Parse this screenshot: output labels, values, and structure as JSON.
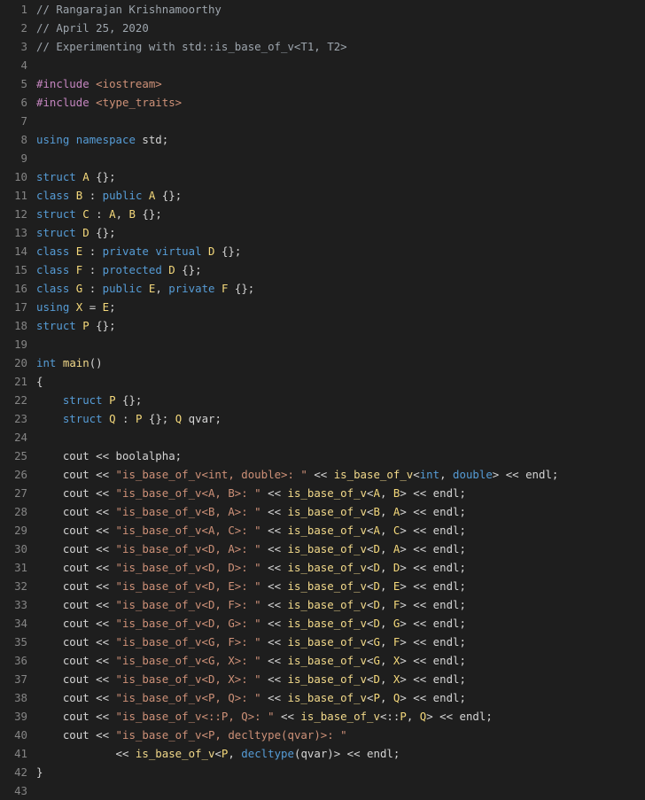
{
  "editor": {
    "language": "cpp",
    "lines": [
      {
        "n": "1",
        "tokens": [
          [
            "cm",
            "// Rangarajan Krishnamoorthy"
          ]
        ]
      },
      {
        "n": "2",
        "tokens": [
          [
            "cm",
            "// April 25, 2020"
          ]
        ]
      },
      {
        "n": "3",
        "tokens": [
          [
            "cm",
            "// Experimenting with std::is_base_of_v<T1, T2>"
          ]
        ]
      },
      {
        "n": "4",
        "tokens": []
      },
      {
        "n": "5",
        "tokens": [
          [
            "pre",
            "#include"
          ],
          [
            "",
            " "
          ],
          [
            "inc",
            "<iostream>"
          ]
        ]
      },
      {
        "n": "6",
        "tokens": [
          [
            "pre",
            "#include"
          ],
          [
            "",
            " "
          ],
          [
            "inc",
            "<type_traits>"
          ]
        ]
      },
      {
        "n": "7",
        "tokens": []
      },
      {
        "n": "8",
        "tokens": [
          [
            "kw",
            "using"
          ],
          [
            "",
            " "
          ],
          [
            "kw",
            "namespace"
          ],
          [
            "",
            " std;"
          ]
        ]
      },
      {
        "n": "9",
        "tokens": []
      },
      {
        "n": "10",
        "tokens": [
          [
            "kw",
            "struct"
          ],
          [
            "",
            " "
          ],
          [
            "ty",
            "A"
          ],
          [
            "",
            " {};"
          ]
        ]
      },
      {
        "n": "11",
        "tokens": [
          [
            "kw",
            "class"
          ],
          [
            "",
            " "
          ],
          [
            "ty",
            "B"
          ],
          [
            "",
            " : "
          ],
          [
            "kw",
            "public"
          ],
          [
            "",
            " "
          ],
          [
            "ty",
            "A"
          ],
          [
            "",
            " {};"
          ]
        ]
      },
      {
        "n": "12",
        "tokens": [
          [
            "kw",
            "struct"
          ],
          [
            "",
            " "
          ],
          [
            "ty",
            "C"
          ],
          [
            "",
            " : "
          ],
          [
            "ty",
            "A"
          ],
          [
            "",
            ", "
          ],
          [
            "ty",
            "B"
          ],
          [
            "",
            " {};"
          ]
        ]
      },
      {
        "n": "13",
        "tokens": [
          [
            "kw",
            "struct"
          ],
          [
            "",
            " "
          ],
          [
            "ty",
            "D"
          ],
          [
            "",
            " {};"
          ]
        ]
      },
      {
        "n": "14",
        "tokens": [
          [
            "kw",
            "class"
          ],
          [
            "",
            " "
          ],
          [
            "ty",
            "E"
          ],
          [
            "",
            " : "
          ],
          [
            "kw",
            "private"
          ],
          [
            "",
            " "
          ],
          [
            "kw",
            "virtual"
          ],
          [
            "",
            " "
          ],
          [
            "ty",
            "D"
          ],
          [
            "",
            " {};"
          ]
        ]
      },
      {
        "n": "15",
        "tokens": [
          [
            "kw",
            "class"
          ],
          [
            "",
            " "
          ],
          [
            "ty",
            "F"
          ],
          [
            "",
            " : "
          ],
          [
            "kw",
            "protected"
          ],
          [
            "",
            " "
          ],
          [
            "ty",
            "D"
          ],
          [
            "",
            " {};"
          ]
        ]
      },
      {
        "n": "16",
        "tokens": [
          [
            "kw",
            "class"
          ],
          [
            "",
            " "
          ],
          [
            "ty",
            "G"
          ],
          [
            "",
            " : "
          ],
          [
            "kw",
            "public"
          ],
          [
            "",
            " "
          ],
          [
            "ty",
            "E"
          ],
          [
            "",
            ", "
          ],
          [
            "kw",
            "private"
          ],
          [
            "",
            " "
          ],
          [
            "ty",
            "F"
          ],
          [
            "",
            " {};"
          ]
        ]
      },
      {
        "n": "17",
        "tokens": [
          [
            "kw",
            "using"
          ],
          [
            "",
            " "
          ],
          [
            "ty",
            "X"
          ],
          [
            "",
            " = "
          ],
          [
            "ty",
            "E"
          ],
          [
            "",
            ";"
          ]
        ]
      },
      {
        "n": "18",
        "tokens": [
          [
            "kw",
            "struct"
          ],
          [
            "",
            " "
          ],
          [
            "ty",
            "P"
          ],
          [
            "",
            " {};"
          ]
        ]
      },
      {
        "n": "19",
        "tokens": []
      },
      {
        "n": "20",
        "tokens": [
          [
            "kw",
            "int"
          ],
          [
            "",
            " "
          ],
          [
            "fn",
            "main"
          ],
          [
            "",
            "()"
          ]
        ]
      },
      {
        "n": "21",
        "tokens": [
          [
            "",
            "{"
          ]
        ]
      },
      {
        "n": "22",
        "tokens": [
          [
            "",
            "    "
          ],
          [
            "kw",
            "struct"
          ],
          [
            "",
            " "
          ],
          [
            "ty",
            "P"
          ],
          [
            "",
            " {};"
          ]
        ]
      },
      {
        "n": "23",
        "tokens": [
          [
            "",
            "    "
          ],
          [
            "kw",
            "struct"
          ],
          [
            "",
            " "
          ],
          [
            "ty",
            "Q"
          ],
          [
            "",
            " : "
          ],
          [
            "ty",
            "P"
          ],
          [
            "",
            " {}; "
          ],
          [
            "ty",
            "Q"
          ],
          [
            "",
            " qvar;"
          ]
        ]
      },
      {
        "n": "24",
        "tokens": []
      },
      {
        "n": "25",
        "tokens": [
          [
            "",
            "    cout << boolalpha;"
          ]
        ]
      },
      {
        "n": "26",
        "tokens": [
          [
            "",
            "    cout << "
          ],
          [
            "str",
            "\"is_base_of_v<int, double>: \""
          ],
          [
            "",
            " << "
          ],
          [
            "fn",
            "is_base_of_v"
          ],
          [
            "",
            "<"
          ],
          [
            "kw",
            "int"
          ],
          [
            "",
            ", "
          ],
          [
            "kw",
            "double"
          ],
          [
            "",
            "> << endl;"
          ]
        ]
      },
      {
        "n": "27",
        "tokens": [
          [
            "",
            "    cout << "
          ],
          [
            "str",
            "\"is_base_of_v<A, B>: \""
          ],
          [
            "",
            " << "
          ],
          [
            "fn",
            "is_base_of_v"
          ],
          [
            "",
            "<"
          ],
          [
            "ty",
            "A"
          ],
          [
            "",
            ", "
          ],
          [
            "ty",
            "B"
          ],
          [
            "",
            "> << endl;"
          ]
        ]
      },
      {
        "n": "28",
        "tokens": [
          [
            "",
            "    cout << "
          ],
          [
            "str",
            "\"is_base_of_v<B, A>: \""
          ],
          [
            "",
            " << "
          ],
          [
            "fn",
            "is_base_of_v"
          ],
          [
            "",
            "<"
          ],
          [
            "ty",
            "B"
          ],
          [
            "",
            ", "
          ],
          [
            "ty",
            "A"
          ],
          [
            "",
            "> << endl;"
          ]
        ]
      },
      {
        "n": "29",
        "tokens": [
          [
            "",
            "    cout << "
          ],
          [
            "str",
            "\"is_base_of_v<A, C>: \""
          ],
          [
            "",
            " << "
          ],
          [
            "fn",
            "is_base_of_v"
          ],
          [
            "",
            "<"
          ],
          [
            "ty",
            "A"
          ],
          [
            "",
            ", "
          ],
          [
            "ty",
            "C"
          ],
          [
            "",
            "> << endl;"
          ]
        ]
      },
      {
        "n": "30",
        "tokens": [
          [
            "",
            "    cout << "
          ],
          [
            "str",
            "\"is_base_of_v<D, A>: \""
          ],
          [
            "",
            " << "
          ],
          [
            "fn",
            "is_base_of_v"
          ],
          [
            "",
            "<"
          ],
          [
            "ty",
            "D"
          ],
          [
            "",
            ", "
          ],
          [
            "ty",
            "A"
          ],
          [
            "",
            "> << endl;"
          ]
        ]
      },
      {
        "n": "31",
        "tokens": [
          [
            "",
            "    cout << "
          ],
          [
            "str",
            "\"is_base_of_v<D, D>: \""
          ],
          [
            "",
            " << "
          ],
          [
            "fn",
            "is_base_of_v"
          ],
          [
            "",
            "<"
          ],
          [
            "ty",
            "D"
          ],
          [
            "",
            ", "
          ],
          [
            "ty",
            "D"
          ],
          [
            "",
            "> << endl;"
          ]
        ]
      },
      {
        "n": "32",
        "tokens": [
          [
            "",
            "    cout << "
          ],
          [
            "str",
            "\"is_base_of_v<D, E>: \""
          ],
          [
            "",
            " << "
          ],
          [
            "fn",
            "is_base_of_v"
          ],
          [
            "",
            "<"
          ],
          [
            "ty",
            "D"
          ],
          [
            "",
            ", "
          ],
          [
            "ty",
            "E"
          ],
          [
            "",
            "> << endl;"
          ]
        ]
      },
      {
        "n": "33",
        "tokens": [
          [
            "",
            "    cout << "
          ],
          [
            "str",
            "\"is_base_of_v<D, F>: \""
          ],
          [
            "",
            " << "
          ],
          [
            "fn",
            "is_base_of_v"
          ],
          [
            "",
            "<"
          ],
          [
            "ty",
            "D"
          ],
          [
            "",
            ", "
          ],
          [
            "ty",
            "F"
          ],
          [
            "",
            "> << endl;"
          ]
        ]
      },
      {
        "n": "34",
        "tokens": [
          [
            "",
            "    cout << "
          ],
          [
            "str",
            "\"is_base_of_v<D, G>: \""
          ],
          [
            "",
            " << "
          ],
          [
            "fn",
            "is_base_of_v"
          ],
          [
            "",
            "<"
          ],
          [
            "ty",
            "D"
          ],
          [
            "",
            ", "
          ],
          [
            "ty",
            "G"
          ],
          [
            "",
            "> << endl;"
          ]
        ]
      },
      {
        "n": "35",
        "tokens": [
          [
            "",
            "    cout << "
          ],
          [
            "str",
            "\"is_base_of_v<G, F>: \""
          ],
          [
            "",
            " << "
          ],
          [
            "fn",
            "is_base_of_v"
          ],
          [
            "",
            "<"
          ],
          [
            "ty",
            "G"
          ],
          [
            "",
            ", "
          ],
          [
            "ty",
            "F"
          ],
          [
            "",
            "> << endl;"
          ]
        ]
      },
      {
        "n": "36",
        "tokens": [
          [
            "",
            "    cout << "
          ],
          [
            "str",
            "\"is_base_of_v<G, X>: \""
          ],
          [
            "",
            " << "
          ],
          [
            "fn",
            "is_base_of_v"
          ],
          [
            "",
            "<"
          ],
          [
            "ty",
            "G"
          ],
          [
            "",
            ", "
          ],
          [
            "ty",
            "X"
          ],
          [
            "",
            "> << endl;"
          ]
        ]
      },
      {
        "n": "37",
        "tokens": [
          [
            "",
            "    cout << "
          ],
          [
            "str",
            "\"is_base_of_v<D, X>: \""
          ],
          [
            "",
            " << "
          ],
          [
            "fn",
            "is_base_of_v"
          ],
          [
            "",
            "<"
          ],
          [
            "ty",
            "D"
          ],
          [
            "",
            ", "
          ],
          [
            "ty",
            "X"
          ],
          [
            "",
            "> << endl;"
          ]
        ]
      },
      {
        "n": "38",
        "tokens": [
          [
            "",
            "    cout << "
          ],
          [
            "str",
            "\"is_base_of_v<P, Q>: \""
          ],
          [
            "",
            " << "
          ],
          [
            "fn",
            "is_base_of_v"
          ],
          [
            "",
            "<"
          ],
          [
            "ty",
            "P"
          ],
          [
            "",
            ", "
          ],
          [
            "ty",
            "Q"
          ],
          [
            "",
            "> << endl;"
          ]
        ]
      },
      {
        "n": "39",
        "tokens": [
          [
            "",
            "    cout << "
          ],
          [
            "str",
            "\"is_base_of_v<::P, Q>: \""
          ],
          [
            "",
            " << "
          ],
          [
            "fn",
            "is_base_of_v"
          ],
          [
            "",
            "<::"
          ],
          [
            "ty",
            "P"
          ],
          [
            "",
            ", "
          ],
          [
            "ty",
            "Q"
          ],
          [
            "",
            "> << endl;"
          ]
        ]
      },
      {
        "n": "40",
        "tokens": [
          [
            "",
            "    cout << "
          ],
          [
            "str",
            "\"is_base_of_v<P, decltype(qvar)>: \""
          ]
        ]
      },
      {
        "n": "41",
        "tokens": [
          [
            "",
            "            << "
          ],
          [
            "fn",
            "is_base_of_v"
          ],
          [
            "",
            "<"
          ],
          [
            "ty",
            "P"
          ],
          [
            "",
            ", "
          ],
          [
            "kw",
            "decltype"
          ],
          [
            "",
            "(qvar)> << endl;"
          ]
        ]
      },
      {
        "n": "42",
        "tokens": [
          [
            "",
            "}"
          ]
        ]
      },
      {
        "n": "43",
        "tokens": []
      }
    ]
  }
}
